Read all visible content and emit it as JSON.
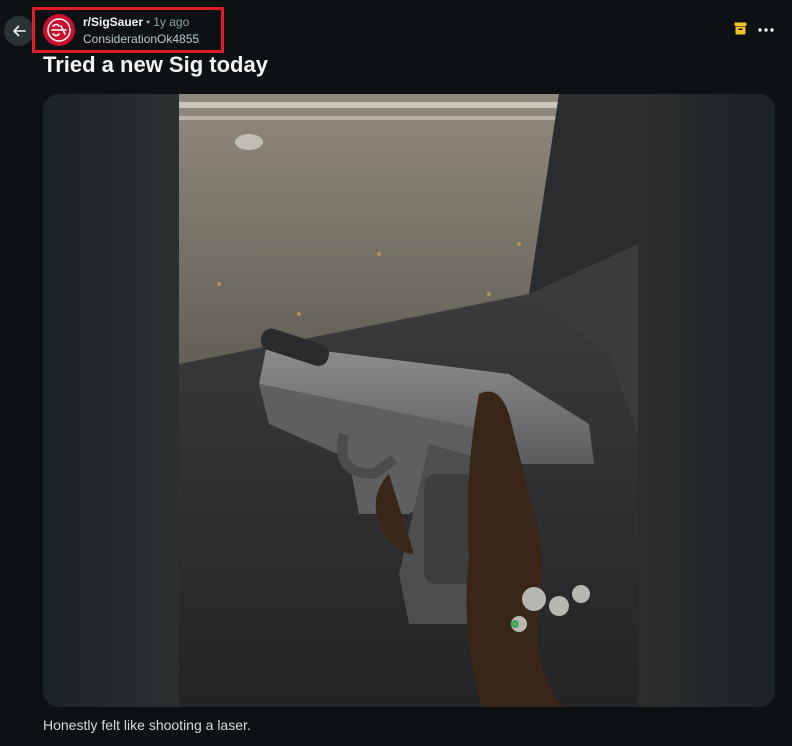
{
  "post": {
    "subreddit": "r/SigSauer",
    "separator": "•",
    "age": "1y ago",
    "author": "ConsiderationOk4855",
    "title": "Tried a new Sig today",
    "body": "Honestly felt like shooting a laser."
  },
  "icons": {
    "back": "arrow-left-icon",
    "archive": "archive-icon",
    "more": "more-horizontal-icon",
    "avatar": "subreddit-avatar"
  },
  "colors": {
    "background": "#0e1113",
    "highlight_box": "#e01b24",
    "archive_icon": "#f2c12e",
    "avatar": "#c8102e",
    "muted_text": "#8ba2ad"
  }
}
